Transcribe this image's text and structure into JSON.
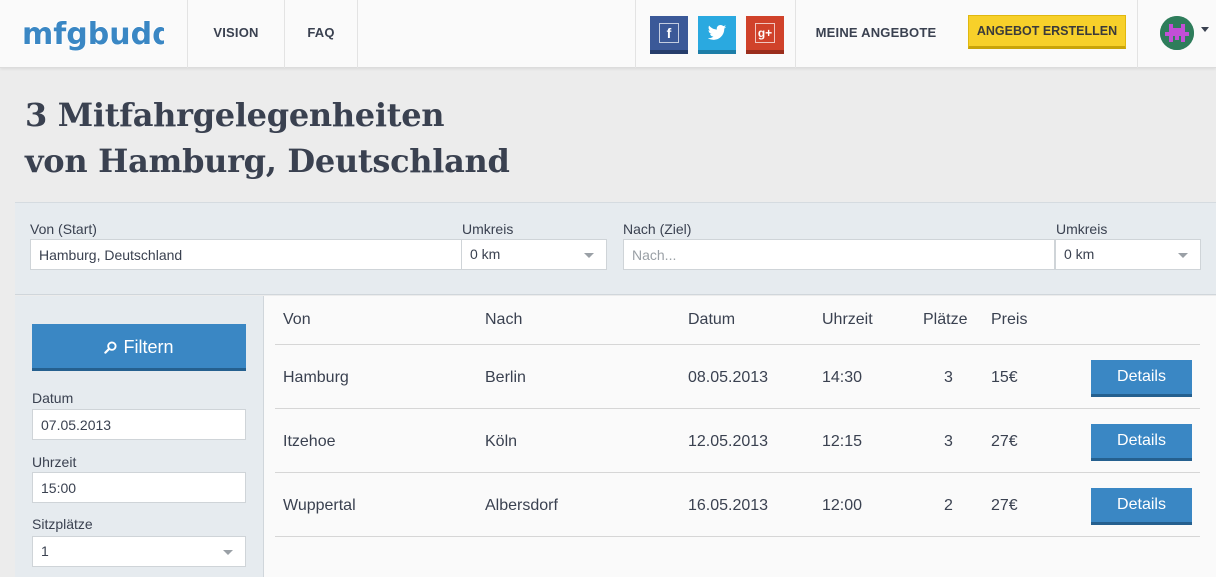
{
  "nav": {
    "logo_text": "mfgbuddy",
    "vision": "VISION",
    "faq": "FAQ",
    "my_offers": "MEINE ANGEBOTE",
    "create_offer": "ANGEBOT ERSTELLEN",
    "social": [
      "facebook-icon",
      "twitter-icon",
      "google-plus-icon"
    ]
  },
  "title": {
    "line1": "3 Mitfahrgelegenheiten",
    "line2": "von Hamburg, Deutschland"
  },
  "search": {
    "from_label": "Von (Start)",
    "from_value": "Hamburg, Deutschland",
    "radius_label": "Umkreis",
    "radius_value": "0 km",
    "to_label": "Nach (Ziel)",
    "to_placeholder": "Nach...",
    "radius2_label": "Umkreis",
    "radius2_value": "0 km"
  },
  "filter": {
    "button_label": "Filtern",
    "date_label": "Datum",
    "date_value": "07.05.2013",
    "time_label": "Uhrzeit",
    "time_value": "15:00",
    "seats_label": "Sitzplätze",
    "seats_value": "1"
  },
  "table": {
    "headers": [
      "Von",
      "Nach",
      "Datum",
      "Uhrzeit",
      "Plätze",
      "Preis"
    ],
    "rows": [
      [
        "Hamburg",
        "Berlin",
        "08.05.2013",
        "14:30",
        "3",
        "15€"
      ],
      [
        "Itzehoe",
        "Köln",
        "12.05.2013",
        "12:15",
        "3",
        "27€"
      ],
      [
        "Wuppertal",
        "Albersdorf",
        "16.05.2013",
        "12:00",
        "2",
        "27€"
      ]
    ],
    "details_label": "Details"
  },
  "colors": {
    "primary_blue": "#3a87c4",
    "cta_yellow": "#f7d02a",
    "logo_blue": "#3a87c4",
    "text": "#3a4150"
  }
}
